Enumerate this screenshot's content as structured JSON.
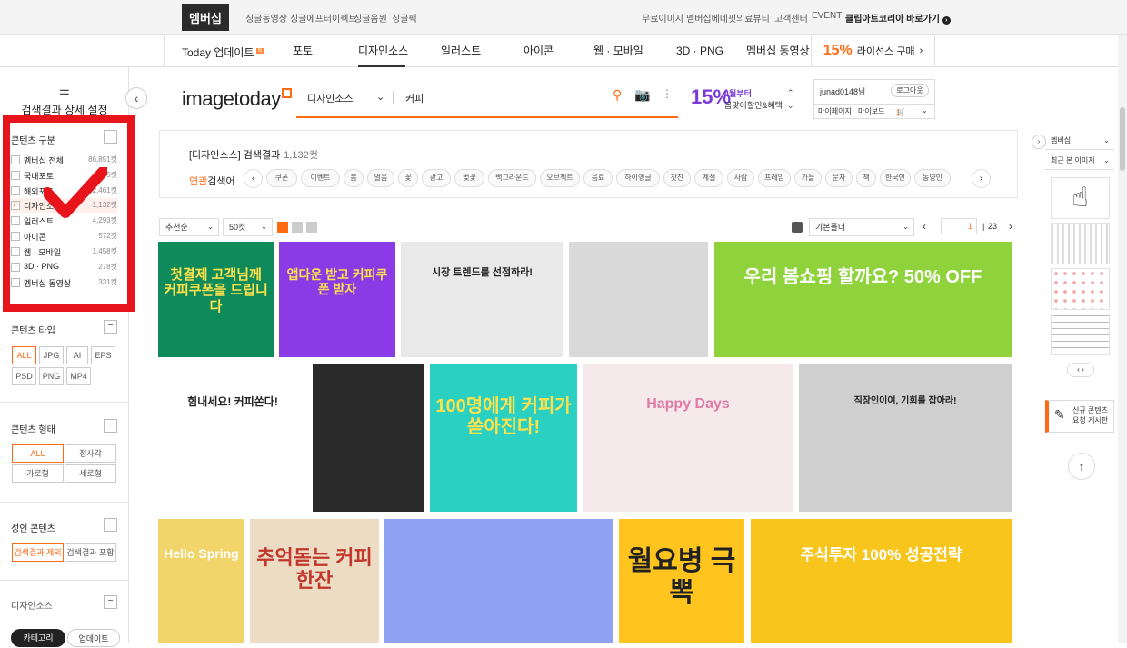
{
  "topbar": {
    "brand": "멤버십",
    "left_links": [
      "싱글동영상",
      "싱글에프터이펙트",
      "싱글음원",
      "싱글팩"
    ],
    "right_links": [
      "무료이미지",
      "멤버십베네핏",
      "의료뷰티",
      "고객센터",
      "EVENT"
    ],
    "highlight_link": "클립아트코리아 바로가기"
  },
  "mainnav": {
    "items": [
      "Today 업데이트",
      "포토",
      "디자인소스",
      "일러스트",
      "아이콘",
      "웹 · 모바일",
      "3D · PNG",
      "멤버십 동영상"
    ],
    "active": "디자인소스",
    "new_badge": "N",
    "promo_pct": "15%",
    "promo_text": "라이선스 구매"
  },
  "sidebar": {
    "title": "검색결과 상세 설정",
    "content_section": {
      "title": "콘텐츠 구분",
      "toggle": "−",
      "items": [
        {
          "label": "멤버십 전체",
          "count": "86,851컷",
          "checked": false
        },
        {
          "label": "국내포토",
          "count": "5컷",
          "checked": false
        },
        {
          "label": "해외포토",
          "count": "72,461컷",
          "checked": false
        },
        {
          "label": "디자인소스",
          "count": "1,132컷",
          "checked": true
        },
        {
          "label": "일러스트",
          "count": "4,293컷",
          "checked": false
        },
        {
          "label": "아이콘",
          "count": "572컷",
          "checked": false
        },
        {
          "label": "웹 · 모바일",
          "count": "1,458컷",
          "checked": false
        },
        {
          "label": "3D · PNG",
          "count": "278컷",
          "checked": false
        },
        {
          "label": "멤버십 동영상",
          "count": "331컷",
          "checked": false
        }
      ]
    },
    "type_section": {
      "title": "콘텐츠 타입",
      "toggle": "−",
      "buttons": [
        "ALL",
        "JPG",
        "AI",
        "EPS",
        "PSD",
        "PNG",
        "MP4"
      ]
    },
    "shape_section": {
      "title": "콘텐츠 형태",
      "toggle": "−",
      "buttons": [
        "ALL",
        "정사각",
        "가로형",
        "세로형"
      ]
    },
    "adult_section": {
      "title": "성인 콘텐츠",
      "toggle": "−",
      "buttons": [
        "검색결과 제외",
        "검색결과 포함"
      ]
    },
    "design_section": {
      "title": "디자인소스",
      "toggle": "−"
    },
    "bottom_tabs": [
      "카테고리",
      "업데이트"
    ]
  },
  "header": {
    "logo": "imagetoday",
    "search_category": "디자인소스",
    "search_query": "커피",
    "promo_pct": "15%",
    "promo_line1": "4월부터",
    "promo_line2": "봄맞이할인&혜택",
    "user": {
      "name": "junad0148님",
      "logout": "로그아웃",
      "mypage": "마이페이지",
      "myboard": "마이보드",
      "cart_count": "1"
    }
  },
  "results": {
    "label": "[디자인소스] 검색결과",
    "count": "1,132컷",
    "related_prefix": "연관",
    "related_suffix": "검색어",
    "chips": [
      "쿠폰",
      "이벤트",
      "봄",
      "얼음",
      "꽃",
      "광고",
      "벚꽃",
      "백그라운드",
      "오브젝트",
      "음료",
      "하이앵글",
      "찻잔",
      "계절",
      "사람",
      "프레임",
      "가을",
      "문자",
      "책",
      "한국인",
      "동양인"
    ]
  },
  "toolbar": {
    "sort": "추천순",
    "per_page": "50컷",
    "folder": "기본폴더",
    "current_page": "1",
    "total_pages": "23"
  },
  "thumbs": [
    {
      "bg": "#0e8a5b",
      "text": "첫결제 고객님께 커피쿠폰을 드립니다",
      "color": "#ffe14a"
    },
    {
      "bg": "#8a3be6",
      "text": "앱다운 받고 커피쿠폰 받자",
      "color": "#ffe14a"
    },
    {
      "bg": "#e9e9e9",
      "text": "시장 트렌드를 선점하라!",
      "color": "#222"
    },
    {
      "bg": "#d9d9d9",
      "text": "",
      "color": "#222"
    },
    {
      "bg": "#8fd23b",
      "text": "우리 봄쇼핑 할까요?  50% OFF",
      "color": "#fff"
    },
    {
      "bg": "#ffffff",
      "text": "힘내세요!  커피쏜다!",
      "color": "#222"
    },
    {
      "bg": "#2a2a2a",
      "text": "",
      "color": "#fff"
    },
    {
      "bg": "#2ad1c3",
      "text": "100명에게 커피가 쏟아진다!",
      "color": "#ffe14a"
    },
    {
      "bg": "#f6e9ec",
      "text": "Happy Days",
      "color": "#e07aa4"
    },
    {
      "bg": "#cfcfcf",
      "text": "직장인이여, 기회를 잡아라!",
      "color": "#222"
    },
    {
      "bg": "#f1d56a",
      "text": "Hello Spring",
      "color": "#fff"
    },
    {
      "bg": "#ecdcc3",
      "text": "추억돋는 커피한잔",
      "color": "#c1372c"
    },
    {
      "bg": "#8fa3f2",
      "text": "",
      "color": "#fff"
    },
    {
      "bg": "#ffc51e",
      "text": "월요병 극뽁",
      "color": "#222"
    },
    {
      "bg": "#f8c51c",
      "text": "주식투자 100% 성공전략",
      "color": "#fff"
    }
  ],
  "rightpanel": {
    "select1": "멤버십",
    "select2": "최근 본 이미지",
    "request_btn": "신규 콘텐츠 요청 게시판"
  },
  "colors": {
    "accent": "#ff6a13",
    "highlight_box": "#e8141c"
  }
}
